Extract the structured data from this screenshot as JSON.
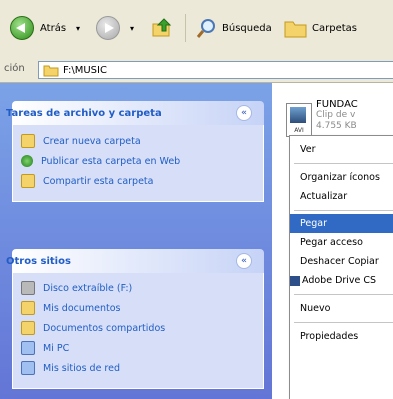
{
  "toolbar": {
    "back_label": "Atrás",
    "search_label": "Búsqueda",
    "folders_label": "Carpetas"
  },
  "address": {
    "label": "ción",
    "value": "F:\\MUSIC"
  },
  "tasks_panel": {
    "title": "Tareas de archivo y carpeta",
    "items": [
      {
        "label": "Crear nueva carpeta"
      },
      {
        "label": "Publicar esta carpeta en Web"
      },
      {
        "label": "Compartir esta carpeta"
      }
    ]
  },
  "places_panel": {
    "title": "Otros sitios",
    "items": [
      {
        "label": "Disco extraíble (F:)"
      },
      {
        "label": "Mis documentos"
      },
      {
        "label": "Documentos compartidos"
      },
      {
        "label": "Mi PC"
      },
      {
        "label": "Mis sitios de red"
      }
    ]
  },
  "file": {
    "name": "FUNDAC",
    "type": "Clip de v",
    "size": "4.755 KB"
  },
  "context_menu": {
    "items": [
      {
        "label": "Ver"
      },
      {
        "label": "Organizar íconos"
      },
      {
        "label": "Actualizar"
      },
      {
        "label": "Pegar"
      },
      {
        "label": "Pegar acceso"
      },
      {
        "label": "Deshacer Copiar"
      },
      {
        "label": "Adobe Drive CS"
      },
      {
        "label": "Nuevo"
      },
      {
        "label": "Propiedades"
      }
    ]
  },
  "colors": {
    "accent": "#316ac5",
    "pane_blue": "#6375d6",
    "link_blue": "#215dc6"
  }
}
